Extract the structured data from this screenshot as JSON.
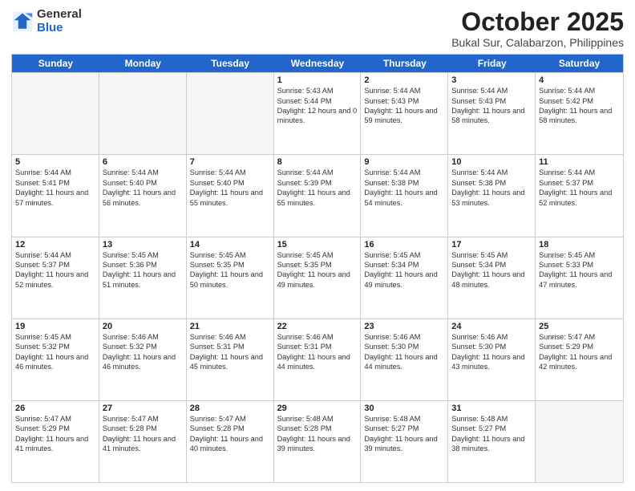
{
  "logo": {
    "general": "General",
    "blue": "Blue"
  },
  "title": {
    "month": "October 2025",
    "location": "Bukal Sur, Calabarzon, Philippines"
  },
  "weekdays": [
    "Sunday",
    "Monday",
    "Tuesday",
    "Wednesday",
    "Thursday",
    "Friday",
    "Saturday"
  ],
  "rows": [
    [
      {
        "date": "",
        "info": ""
      },
      {
        "date": "",
        "info": ""
      },
      {
        "date": "",
        "info": ""
      },
      {
        "date": "1",
        "info": "Sunrise: 5:43 AM\nSunset: 5:44 PM\nDaylight: 12 hours and 0 minutes."
      },
      {
        "date": "2",
        "info": "Sunrise: 5:44 AM\nSunset: 5:43 PM\nDaylight: 11 hours and 59 minutes."
      },
      {
        "date": "3",
        "info": "Sunrise: 5:44 AM\nSunset: 5:43 PM\nDaylight: 11 hours and 58 minutes."
      },
      {
        "date": "4",
        "info": "Sunrise: 5:44 AM\nSunset: 5:42 PM\nDaylight: 11 hours and 58 minutes."
      }
    ],
    [
      {
        "date": "5",
        "info": "Sunrise: 5:44 AM\nSunset: 5:41 PM\nDaylight: 11 hours and 57 minutes."
      },
      {
        "date": "6",
        "info": "Sunrise: 5:44 AM\nSunset: 5:40 PM\nDaylight: 11 hours and 56 minutes."
      },
      {
        "date": "7",
        "info": "Sunrise: 5:44 AM\nSunset: 5:40 PM\nDaylight: 11 hours and 55 minutes."
      },
      {
        "date": "8",
        "info": "Sunrise: 5:44 AM\nSunset: 5:39 PM\nDaylight: 11 hours and 55 minutes."
      },
      {
        "date": "9",
        "info": "Sunrise: 5:44 AM\nSunset: 5:38 PM\nDaylight: 11 hours and 54 minutes."
      },
      {
        "date": "10",
        "info": "Sunrise: 5:44 AM\nSunset: 5:38 PM\nDaylight: 11 hours and 53 minutes."
      },
      {
        "date": "11",
        "info": "Sunrise: 5:44 AM\nSunset: 5:37 PM\nDaylight: 11 hours and 52 minutes."
      }
    ],
    [
      {
        "date": "12",
        "info": "Sunrise: 5:44 AM\nSunset: 5:37 PM\nDaylight: 11 hours and 52 minutes."
      },
      {
        "date": "13",
        "info": "Sunrise: 5:45 AM\nSunset: 5:36 PM\nDaylight: 11 hours and 51 minutes."
      },
      {
        "date": "14",
        "info": "Sunrise: 5:45 AM\nSunset: 5:35 PM\nDaylight: 11 hours and 50 minutes."
      },
      {
        "date": "15",
        "info": "Sunrise: 5:45 AM\nSunset: 5:35 PM\nDaylight: 11 hours and 49 minutes."
      },
      {
        "date": "16",
        "info": "Sunrise: 5:45 AM\nSunset: 5:34 PM\nDaylight: 11 hours and 49 minutes."
      },
      {
        "date": "17",
        "info": "Sunrise: 5:45 AM\nSunset: 5:34 PM\nDaylight: 11 hours and 48 minutes."
      },
      {
        "date": "18",
        "info": "Sunrise: 5:45 AM\nSunset: 5:33 PM\nDaylight: 11 hours and 47 minutes."
      }
    ],
    [
      {
        "date": "19",
        "info": "Sunrise: 5:45 AM\nSunset: 5:32 PM\nDaylight: 11 hours and 46 minutes."
      },
      {
        "date": "20",
        "info": "Sunrise: 5:46 AM\nSunset: 5:32 PM\nDaylight: 11 hours and 46 minutes."
      },
      {
        "date": "21",
        "info": "Sunrise: 5:46 AM\nSunset: 5:31 PM\nDaylight: 11 hours and 45 minutes."
      },
      {
        "date": "22",
        "info": "Sunrise: 5:46 AM\nSunset: 5:31 PM\nDaylight: 11 hours and 44 minutes."
      },
      {
        "date": "23",
        "info": "Sunrise: 5:46 AM\nSunset: 5:30 PM\nDaylight: 11 hours and 44 minutes."
      },
      {
        "date": "24",
        "info": "Sunrise: 5:46 AM\nSunset: 5:30 PM\nDaylight: 11 hours and 43 minutes."
      },
      {
        "date": "25",
        "info": "Sunrise: 5:47 AM\nSunset: 5:29 PM\nDaylight: 11 hours and 42 minutes."
      }
    ],
    [
      {
        "date": "26",
        "info": "Sunrise: 5:47 AM\nSunset: 5:29 PM\nDaylight: 11 hours and 41 minutes."
      },
      {
        "date": "27",
        "info": "Sunrise: 5:47 AM\nSunset: 5:28 PM\nDaylight: 11 hours and 41 minutes."
      },
      {
        "date": "28",
        "info": "Sunrise: 5:47 AM\nSunset: 5:28 PM\nDaylight: 11 hours and 40 minutes."
      },
      {
        "date": "29",
        "info": "Sunrise: 5:48 AM\nSunset: 5:28 PM\nDaylight: 11 hours and 39 minutes."
      },
      {
        "date": "30",
        "info": "Sunrise: 5:48 AM\nSunset: 5:27 PM\nDaylight: 11 hours and 39 minutes."
      },
      {
        "date": "31",
        "info": "Sunrise: 5:48 AM\nSunset: 5:27 PM\nDaylight: 11 hours and 38 minutes."
      },
      {
        "date": "",
        "info": ""
      }
    ]
  ]
}
